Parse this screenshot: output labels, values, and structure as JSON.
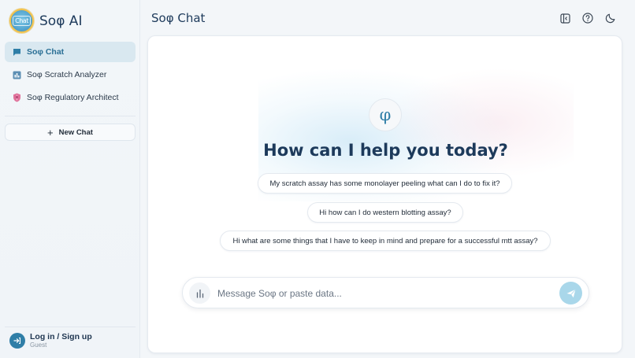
{
  "brand": {
    "name": "Soφ AI",
    "logo_text": "Chat"
  },
  "sidebar": {
    "items": [
      {
        "label": "Soφ Chat",
        "icon": "chat-bubble-icon",
        "active": true
      },
      {
        "label": "Soφ Scratch Analyzer",
        "icon": "bar-chart-icon",
        "active": false
      },
      {
        "label": "Soφ Regulatory Architect",
        "icon": "shield-icon",
        "active": false
      }
    ],
    "new_chat_label": "New Chat",
    "login": {
      "title": "Log in / Sign up",
      "subtitle": "Guest"
    }
  },
  "header": {
    "title": "Soφ Chat",
    "icons": [
      "collapse-sidebar-icon",
      "help-icon",
      "dark-mode-icon"
    ]
  },
  "main": {
    "symbol": "φ",
    "headline": "How can I help you today?",
    "suggestions": [
      "My scratch assay has some monolayer peeling what can I do to fix it?",
      "Hi how can I do western blotting assay?",
      "Hi what are some things that I have to keep in mind and prepare for a successful mtt assay?"
    ],
    "composer": {
      "placeholder": "Message Soφ or paste data..."
    }
  },
  "colors": {
    "accent": "#2f7ea7",
    "title": "#1d3a5b",
    "send_button": "#a9d7ea",
    "active_nav": "#d9e8f0"
  }
}
